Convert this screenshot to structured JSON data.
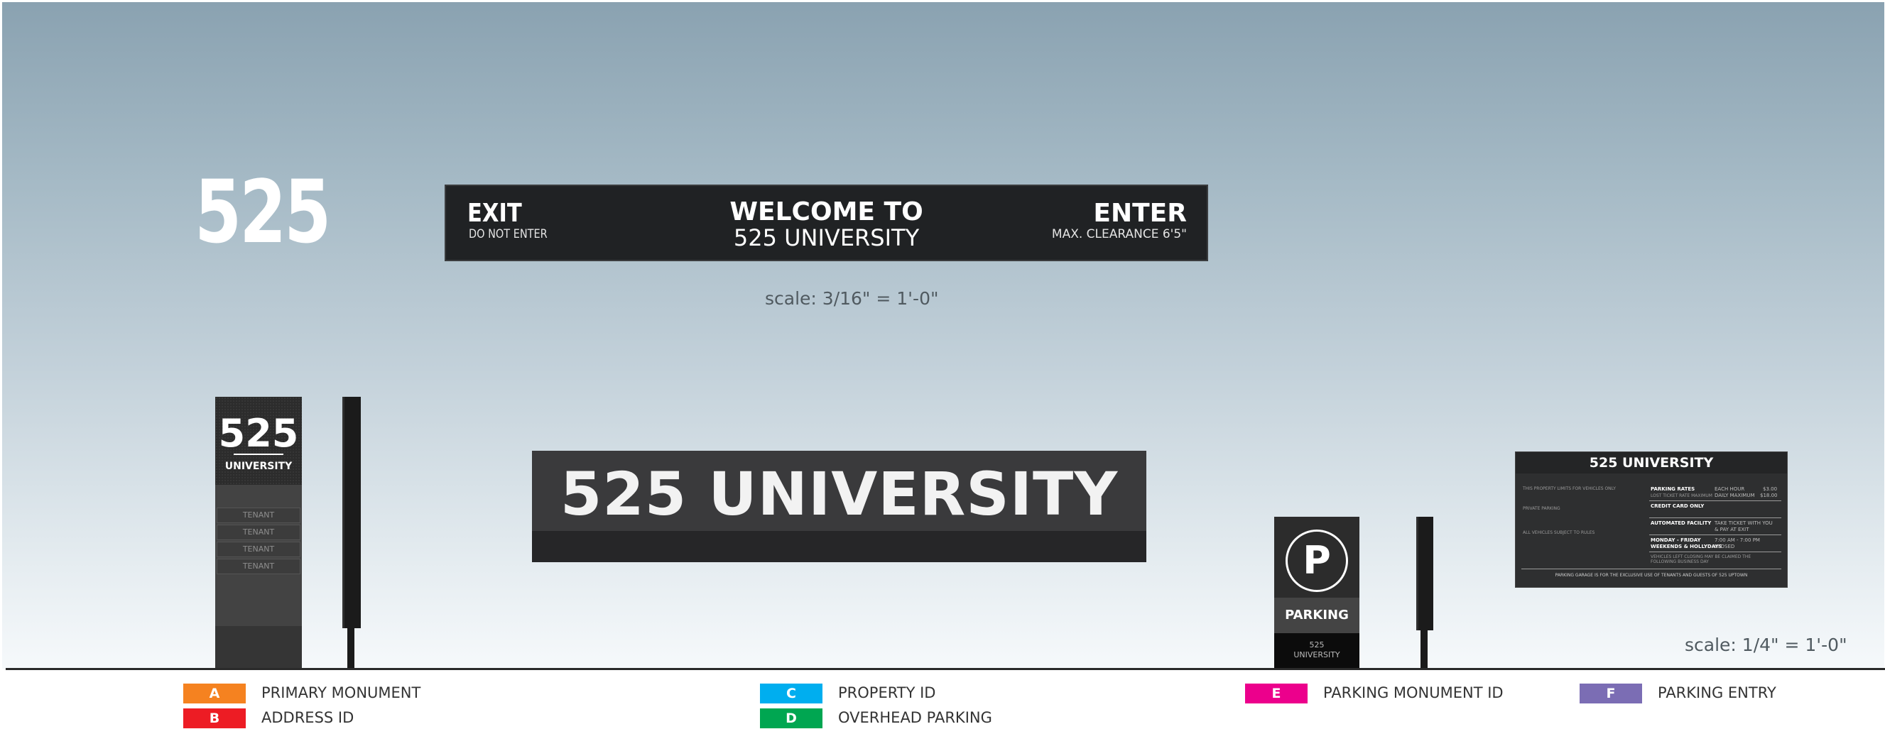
{
  "address_id": {
    "number": "525"
  },
  "overhead_sign": {
    "exit": "EXIT",
    "exit_sub": "DO NOT ENTER",
    "welcome_line1": "WELCOME TO",
    "welcome_line2": "525 UNIVERSITY",
    "enter": "ENTER",
    "enter_sub": "MAX. CLEARANCE 6'5\""
  },
  "scale_overhead": "scale: 3/16\" = 1'-0\"",
  "scale_parking": "scale: 1/4\" = 1'-0\"",
  "primary_monument": {
    "number": "525",
    "name": "UNIVERSITY",
    "tenants": [
      "TENANT",
      "TENANT",
      "TENANT",
      "TENANT"
    ]
  },
  "property_id": {
    "text": "525 UNIVERSITY"
  },
  "parking_monument": {
    "symbol": "P",
    "label": "PARKING",
    "footer_line1": "525",
    "footer_line2": "UNIVERSITY"
  },
  "parking_entry": {
    "title": "525 UNIVERSITY",
    "left_notes": [
      "THIS PROPERTY LIMITS FOR VEHICLES ONLY",
      "PRIVATE PARKING",
      "ALL VEHICLES SUBJECT TO RULES"
    ],
    "rows": [
      {
        "label": "PARKING RATES",
        "sub": "LOST TICKET RATE MAXIMUM",
        "value1": "EACH HOUR",
        "value2": "DAILY MAXIMUM",
        "price1": "$3.00",
        "price2": "$18.00"
      },
      {
        "label": "CREDIT CARD ONLY",
        "sub": "",
        "value1": "",
        "value2": "",
        "price1": "",
        "price2": ""
      },
      {
        "label": "AUTOMATED FACILITY",
        "sub": "",
        "value1": "TAKE TICKET WITH YOU",
        "value2": "& PAY AT EXIT",
        "price1": "",
        "price2": ""
      },
      {
        "label": "MONDAY - FRIDAY",
        "sub": "WEEKENDS & HOLLYDAYS",
        "value1": "7:00 AM - 7:00 PM",
        "value2": "CLOSED",
        "price1": "",
        "price2": ""
      }
    ],
    "notice": "VEHICLES LEFT CLOSING MAY BE CLAIMED THE FOLLOWING BUSINESS DAY",
    "footer": "PARKING GARAGE IS FOR THE EXCLUSIVE USE OF TENANTS AND GUESTS OF 525 UPTOWN"
  },
  "legend": [
    {
      "letter": "A",
      "label": "PRIMARY MONUMENT",
      "color": "#f58220"
    },
    {
      "letter": "B",
      "label": "ADDRESS ID",
      "color": "#ed1c24"
    },
    {
      "letter": "C",
      "label": "PROPERTY ID",
      "color": "#00aeef"
    },
    {
      "letter": "D",
      "label": "OVERHEAD PARKING",
      "color": "#00a651"
    },
    {
      "letter": "E",
      "label": "PARKING MONUMENT ID",
      "color": "#ec008c"
    },
    {
      "letter": "F",
      "label": "PARKING ENTRY",
      "color": "#7b6db4"
    }
  ]
}
